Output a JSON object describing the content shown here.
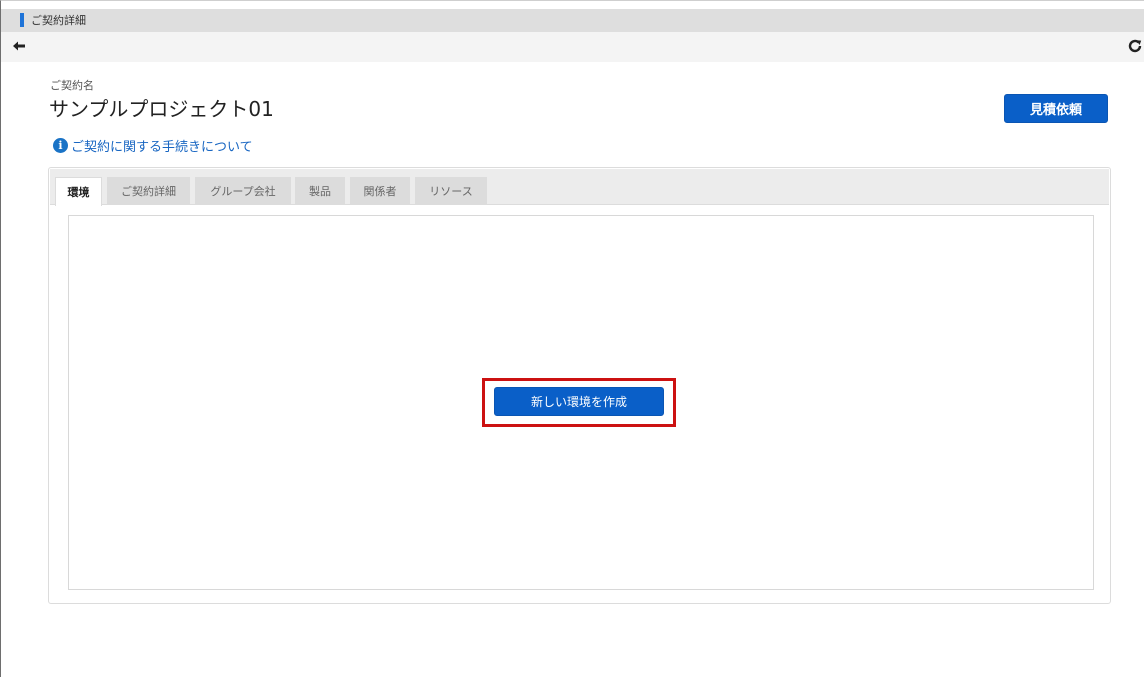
{
  "window": {
    "title": "ご契約詳細"
  },
  "nav": {
    "back_icon": "arrow-left-icon",
    "refresh_icon": "refresh-icon"
  },
  "header": {
    "contract_label": "ご契約名",
    "contract_name": "サンプルプロジェクト01",
    "quote_button_label": "見積依頼",
    "info_link_text": "ご契約に関する手続きについて",
    "info_icon_glyph": "i"
  },
  "tabs": [
    {
      "label": "環境",
      "active": true
    },
    {
      "label": "ご契約詳細",
      "active": false
    },
    {
      "label": "グループ会社",
      "active": false
    },
    {
      "label": "製品",
      "active": false
    },
    {
      "label": "関係者",
      "active": false
    },
    {
      "label": "リソース",
      "active": false
    }
  ],
  "content": {
    "create_button_label": "新しい環境を作成"
  },
  "colors": {
    "primary_button": "#0a5fc8",
    "link": "#1866c2",
    "highlight_border": "#cc1111",
    "title_marker": "#1e73d8"
  }
}
